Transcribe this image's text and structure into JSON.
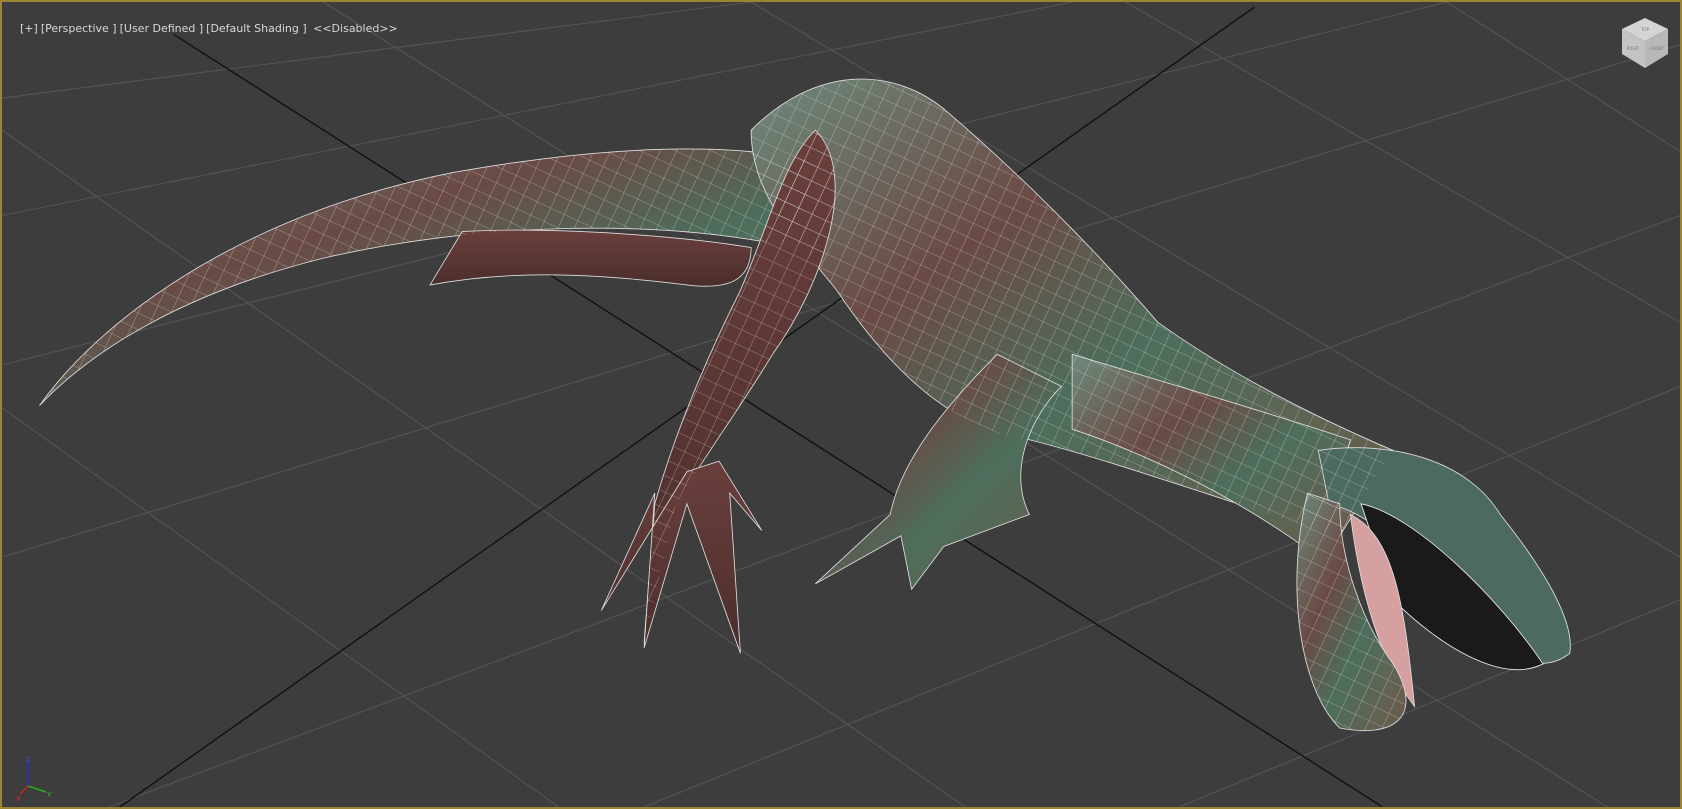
{
  "viewport": {
    "labels": {
      "menu": "[+]",
      "view": "[Perspective ]",
      "camera": "[User Defined ]",
      "shading": "[Default Shading ]",
      "extra": "<<Disabled>>"
    },
    "viewcube": {
      "top": "TOP",
      "left": "RIGHT",
      "right": "FRONT"
    },
    "axis_gizmo": {
      "x": "X",
      "y": "Y",
      "z": "Z"
    },
    "colors": {
      "background": "#3d3d3d",
      "border_active": "#9c8434",
      "grid": "#555555",
      "grid_axis": "#111111"
    }
  }
}
